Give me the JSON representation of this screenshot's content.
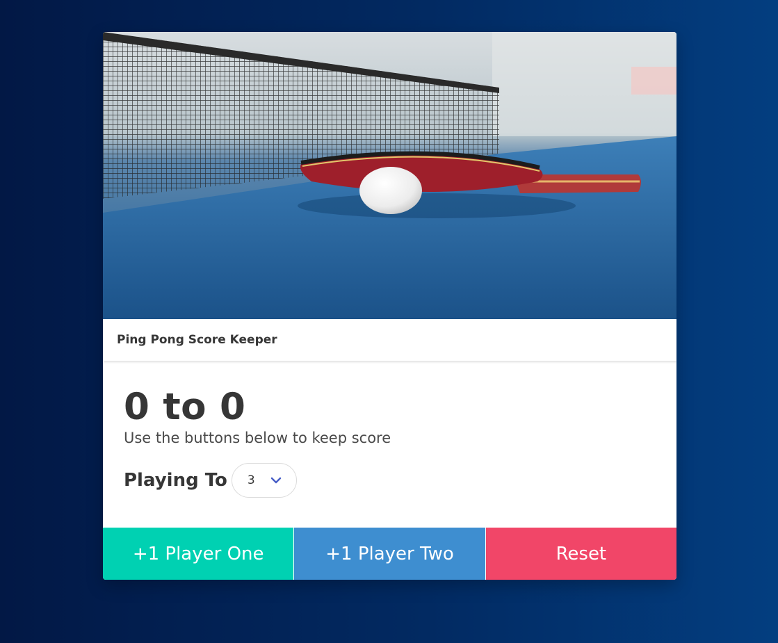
{
  "card": {
    "image_alt": "Ping pong paddle and ball on a blue table next to the net",
    "title": "Ping Pong Score Keeper"
  },
  "score": {
    "player_one": 0,
    "player_two": 0,
    "display": "0 to 0",
    "hint": "Use the buttons below to keep score"
  },
  "playing_to": {
    "label": "Playing To",
    "selected": "3"
  },
  "buttons": {
    "player_one": "+1 Player One",
    "player_two": "+1 Player Two",
    "reset": "Reset"
  },
  "colors": {
    "player_one": "#00d1b2",
    "player_two": "#3e8ed0",
    "reset": "#f14668"
  }
}
